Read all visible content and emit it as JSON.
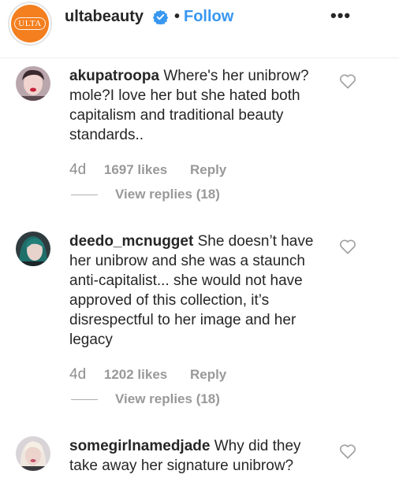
{
  "header": {
    "logo_text": "ULTA",
    "username": "ultabeauty",
    "separator": "•",
    "follow_label": "Follow",
    "more_label": "•••"
  },
  "colors": {
    "brand": "#f47f1f",
    "follow": "#3897f0",
    "verified": "#3897f0",
    "meta": "#999999"
  },
  "comments": [
    {
      "username": "akupatroopa",
      "text": "Where's her unibrow?mole?I love her but she hated both capitalism and traditional beauty standards..",
      "age": "4d",
      "likes": "1697 likes",
      "reply_label": "Reply",
      "view_replies": "View replies (18)"
    },
    {
      "username": "deedo_mcnugget",
      "text": "She doesn’t have her unibrow and she was a staunch anti-capitalist... she would not have approved of this collection, it’s disrespectful to her image and her legacy",
      "age": "4d",
      "likes": "1202 likes",
      "reply_label": "Reply",
      "view_replies": "View replies (18)"
    },
    {
      "username": "somegirlnamedjade",
      "text": "Why did they take away her signature unibrow?"
    }
  ],
  "icons": {
    "verified": "verified-badge-icon",
    "heart": "heart-outline-icon",
    "more": "more-options-icon"
  }
}
